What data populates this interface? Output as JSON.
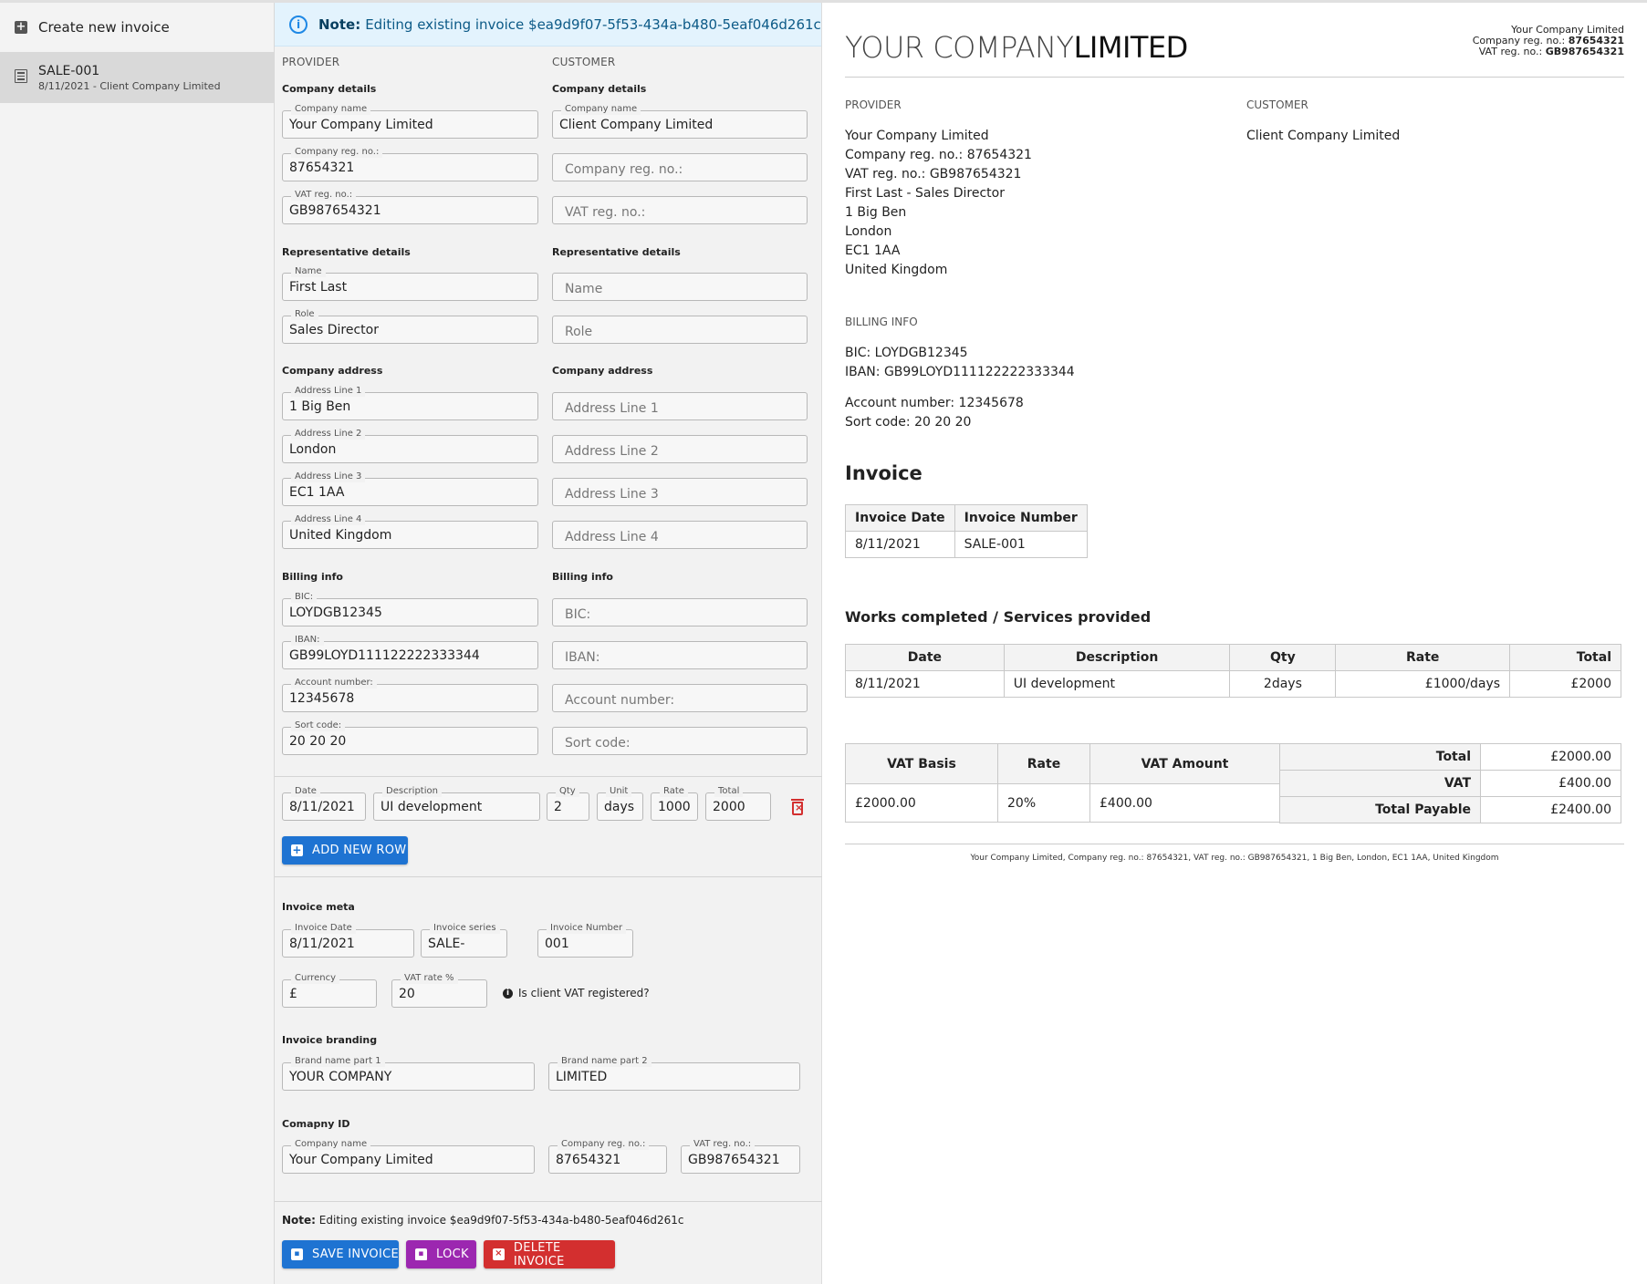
{
  "sidebar": {
    "create_label": "Create new invoice",
    "items": [
      {
        "title": "SALE-001",
        "subtitle": "8/11/2021 - Client Company Limited"
      }
    ]
  },
  "editor": {
    "note_top": {
      "bold": "Note:",
      "text": "Editing existing invoice $ea9d9f07-5f53-434a-b480-5eaf046d261c"
    },
    "provider": {
      "heading": "PROVIDER",
      "company_details": "Company details",
      "company_name": {
        "label": "Company name",
        "value": "Your Company Limited"
      },
      "company_reg": {
        "label": "Company reg. no.:",
        "value": "87654321"
      },
      "vat_reg": {
        "label": "VAT reg. no.:",
        "value": "GB987654321"
      },
      "rep_details": "Representative details",
      "rep_name": {
        "label": "Name",
        "value": "First Last"
      },
      "rep_role": {
        "label": "Role",
        "value": "Sales Director"
      },
      "company_address": "Company address",
      "addr1": {
        "label": "Address Line 1",
        "value": "1 Big Ben"
      },
      "addr2": {
        "label": "Address Line 2",
        "value": "London"
      },
      "addr3": {
        "label": "Address Line 3",
        "value": "EC1 1AA"
      },
      "addr4": {
        "label": "Address Line 4",
        "value": "United Kingdom"
      },
      "billing_info": "Billing info",
      "bic": {
        "label": "BIC:",
        "value": "LOYDGB12345"
      },
      "iban": {
        "label": "IBAN:",
        "value": "GB99LOYD111122222333344"
      },
      "account": {
        "label": "Account number:",
        "value": "12345678"
      },
      "sort": {
        "label": "Sort code:",
        "value": "20 20 20"
      }
    },
    "customer": {
      "heading": "CUSTOMER",
      "company_details": "Company details",
      "company_name": {
        "label": "Company name",
        "value": "Client Company Limited"
      },
      "company_reg_placeholder": "Company reg. no.:",
      "vat_reg_placeholder": "VAT reg. no.:",
      "rep_details": "Representative details",
      "name_placeholder": "Name",
      "role_placeholder": "Role",
      "company_address": "Company address",
      "addr1_placeholder": "Address Line 1",
      "addr2_placeholder": "Address Line 2",
      "addr3_placeholder": "Address Line 3",
      "addr4_placeholder": "Address Line 4",
      "billing_info": "Billing info",
      "bic_placeholder": "BIC:",
      "iban_placeholder": "IBAN:",
      "account_placeholder": "Account number:",
      "sort_placeholder": "Sort code:"
    },
    "row": {
      "date": {
        "label": "Date",
        "value": "8/11/2021"
      },
      "description": {
        "label": "Description",
        "value": "UI development"
      },
      "qty": {
        "label": "Qty",
        "value": "2"
      },
      "unit": {
        "label": "Unit",
        "value": "days"
      },
      "rate": {
        "label": "Rate",
        "value": "1000"
      },
      "total": {
        "label": "Total",
        "value": "2000"
      }
    },
    "add_row_label": "ADD NEW ROW",
    "meta": {
      "heading": "Invoice meta",
      "date": {
        "label": "Invoice Date",
        "value": "8/11/2021"
      },
      "series": {
        "label": "Invoice series",
        "value": "SALE-"
      },
      "number": {
        "label": "Invoice Number",
        "value": "001"
      },
      "currency": {
        "label": "Currency",
        "value": "£"
      },
      "vat_rate": {
        "label": "VAT rate %",
        "value": "20"
      },
      "vat_registered_label": "Is client VAT registered?"
    },
    "branding": {
      "heading": "Invoice branding",
      "part1": {
        "label": "Brand name part 1",
        "value": "YOUR COMPANY"
      },
      "part2": {
        "label": "Brand name part 2",
        "value": "LIMITED"
      }
    },
    "company_id": {
      "heading": "Comapny ID",
      "name": {
        "label": "Company name",
        "value": "Your Company Limited"
      },
      "reg": {
        "label": "Company reg. no.:",
        "value": "87654321"
      },
      "vat": {
        "label": "VAT reg. no.:",
        "value": "GB987654321"
      }
    },
    "note_bottom": {
      "bold": "Note:",
      "text": "Editing existing invoice $ea9d9f07-5f53-434a-b480-5eaf046d261c"
    },
    "buttons": {
      "save": "SAVE INVOICE",
      "lock": "LOCK",
      "delete": "DELETE INVOICE"
    }
  },
  "preview": {
    "brand_part1": "YOUR COMPANY",
    "brand_part2": "LIMITED",
    "header": {
      "company": "Your Company Limited",
      "reg_label": "Company reg. no.:",
      "reg_value": "87654321",
      "vat_label": "VAT reg. no.:",
      "vat_value": "GB987654321"
    },
    "provider_label": "PROVIDER",
    "customer_label": "CUSTOMER",
    "provider_lines": [
      "Your Company Limited",
      "Company reg. no.: 87654321",
      "VAT reg. no.: GB987654321",
      "First Last - Sales Director",
      "1 Big Ben",
      "London",
      "EC1 1AA",
      "United Kingdom"
    ],
    "customer_lines": [
      "Client Company Limited"
    ],
    "billing_label": "BILLING INFO",
    "billing_lines": [
      "BIC: LOYDGB12345",
      "IBAN: GB99LOYD111122222333344"
    ],
    "bank_lines": [
      "Account number: 12345678",
      "Sort code: 20 20 20"
    ],
    "invoice_title": "Invoice",
    "invoice_table": {
      "headers": [
        "Invoice Date",
        "Invoice Number"
      ],
      "row": [
        "8/11/2021",
        "SALE-001"
      ]
    },
    "works_title": "Works completed / Services provided",
    "works_table": {
      "headers": [
        "Date",
        "Description",
        "Qty",
        "Rate",
        "Total"
      ],
      "rows": [
        [
          "8/11/2021",
          "UI development",
          "2days",
          "£1000/days",
          "£2000"
        ]
      ]
    },
    "vat_table": {
      "headers": [
        "VAT Basis",
        "Rate",
        "VAT Amount"
      ],
      "row": [
        "£2000.00",
        "20%",
        "£400.00"
      ]
    },
    "totals": [
      {
        "label": "Total",
        "value": "£2000.00"
      },
      {
        "label": "VAT",
        "value": "£400.00"
      },
      {
        "label": "Total Payable",
        "value": "£2400.00"
      }
    ],
    "footer": "Your Company Limited,  Company reg. no.: 87654321,  VAT reg. no.: GB987654321,  1 Big Ben,  London,  EC1 1AA,  United Kingdom"
  },
  "colors": {
    "save": "#1e73d2",
    "lock": "#9c27b0",
    "delete": "#d32f2f",
    "add_row": "#1e73d2",
    "note_bg": "#e3f3fd"
  }
}
